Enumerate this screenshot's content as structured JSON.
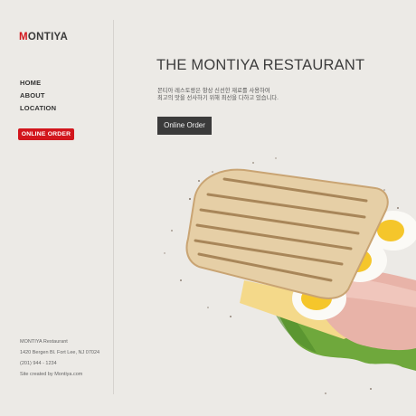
{
  "brand": {
    "logo_initial": "M",
    "logo_rest": "ONTIYA"
  },
  "nav": {
    "items": [
      "HOME",
      "ABOUT",
      "LOCATION"
    ]
  },
  "sidebar_cta": "ONLINE ORDER",
  "main": {
    "title": "THE MONTIYA RESTAURANT",
    "desc_lines": [
      "몬티아 레스토랑은 항상 신선한 재료를 사용하여",
      "최고의 맛을 선사하기 위해 최선을 다하고 있습니다."
    ],
    "cta": "Online Order"
  },
  "footer": {
    "name": "MONTIYA Restaurant",
    "address": "1420 Bergen Bl. Fort Lee, NJ 07024",
    "phone": "(201) 944 - 1234",
    "credit": "Site created by Montiya.com"
  },
  "colors": {
    "accent": "#d2161d",
    "dark_button": "#3b3b3b",
    "background": "#eceae6"
  }
}
